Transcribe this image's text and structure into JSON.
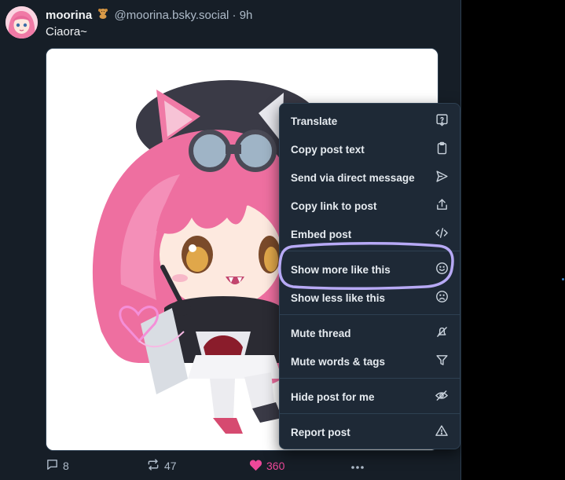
{
  "post": {
    "display_name": "moorina",
    "emoji_icon": "teddy-bear-icon",
    "handle": "@moorina.bsky.social",
    "separator": "·",
    "time": "9h",
    "text": "Ciaora~"
  },
  "actions": {
    "reply_count": "8",
    "repost_count": "47",
    "like_count": "360"
  },
  "menu": {
    "items": [
      {
        "label": "Translate",
        "icon": "translate-icon"
      },
      {
        "label": "Copy post text",
        "icon": "clipboard-icon"
      },
      {
        "label": "Send via direct message",
        "icon": "send-icon"
      },
      {
        "label": "Copy link to post",
        "icon": "share-icon"
      },
      {
        "label": "Embed post",
        "icon": "code-icon"
      },
      {
        "label": "Show more like this",
        "icon": "smile-icon"
      },
      {
        "label": "Show less like this",
        "icon": "frown-icon"
      },
      {
        "label": "Mute thread",
        "icon": "mute-icon"
      },
      {
        "label": "Mute words & tags",
        "icon": "filter-icon"
      },
      {
        "label": "Hide post for me",
        "icon": "eye-slash-icon"
      },
      {
        "label": "Report post",
        "icon": "warning-icon"
      }
    ]
  },
  "colors": {
    "background": "#161e27",
    "menu_background": "#1e2936",
    "like": "#ec4899",
    "highlight_annotation": "#b7a9f5"
  }
}
